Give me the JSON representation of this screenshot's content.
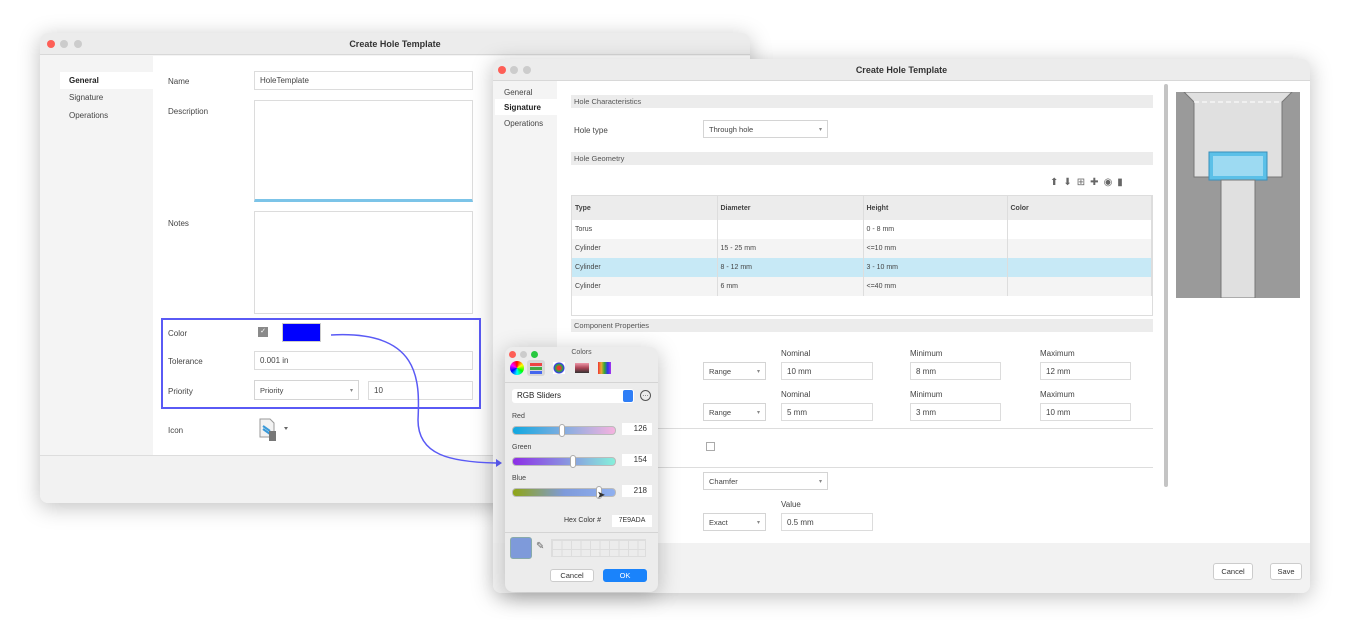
{
  "window1": {
    "title": "Create Hole Template",
    "nav": [
      "General",
      "Signature",
      "Operations"
    ],
    "fields": {
      "name_label": "Name",
      "name_value": "HoleTemplate",
      "description_label": "Description",
      "notes_label": "Notes",
      "color_label": "Color",
      "color_value": "#0000ff",
      "tolerance_label": "Tolerance",
      "tolerance_value": "0.001 in",
      "priority_label": "Priority",
      "priority_select": "Priority",
      "priority_value": "10",
      "icon_label": "Icon"
    }
  },
  "window2": {
    "title": "Create Hole Template",
    "nav": [
      "General",
      "Signature",
      "Operations"
    ],
    "hole_characteristics": "Hole Characteristics",
    "hole_type_label": "Hole type",
    "hole_type_value": "Through hole",
    "hole_geometry": "Hole Geometry",
    "table": {
      "headers": [
        "Type",
        "Diameter",
        "Height",
        "Color"
      ],
      "rows": [
        [
          "Torus",
          "",
          "0 - 8 mm",
          ""
        ],
        [
          "Cylinder",
          "15 - 25 mm",
          "<=10 mm",
          ""
        ],
        [
          "Cylinder",
          "8 - 12 mm",
          "3 - 10 mm",
          ""
        ],
        [
          "Cylinder",
          "6 mm",
          "<=40 mm",
          ""
        ]
      ]
    },
    "component_properties": "Component Properties",
    "prop_rows": [
      {
        "mode": "Range",
        "nominal_label": "Nominal",
        "nominal": "10 mm",
        "minimum_label": "Minimum",
        "minimum": "8 mm",
        "maximum_label": "Maximum",
        "maximum": "12 mm"
      },
      {
        "mode": "Range",
        "nominal_label": "Nominal",
        "nominal": "5 mm",
        "minimum_label": "Minimum",
        "minimum": "3 mm",
        "maximum_label": "Maximum",
        "maximum": "10 mm"
      }
    ],
    "edge_type": "Chamfer",
    "value_label": "Value",
    "value_mode": "Exact",
    "value": "0.5 mm",
    "cancel": "Cancel",
    "save": "Save"
  },
  "colors": {
    "title": "Colors",
    "mode": "RGB Sliders",
    "red_label": "Red",
    "red": "126",
    "green_label": "Green",
    "green": "154",
    "blue_label": "Blue",
    "blue": "218",
    "red_fraction": 0.494,
    "green_fraction": 0.604,
    "blue_fraction": 0.855,
    "hex_label": "Hex Color #",
    "hex": "7E9ADA",
    "swatch": "#7e9ada",
    "cancel": "Cancel",
    "ok": "OK"
  },
  "accent": "#4a4af0"
}
